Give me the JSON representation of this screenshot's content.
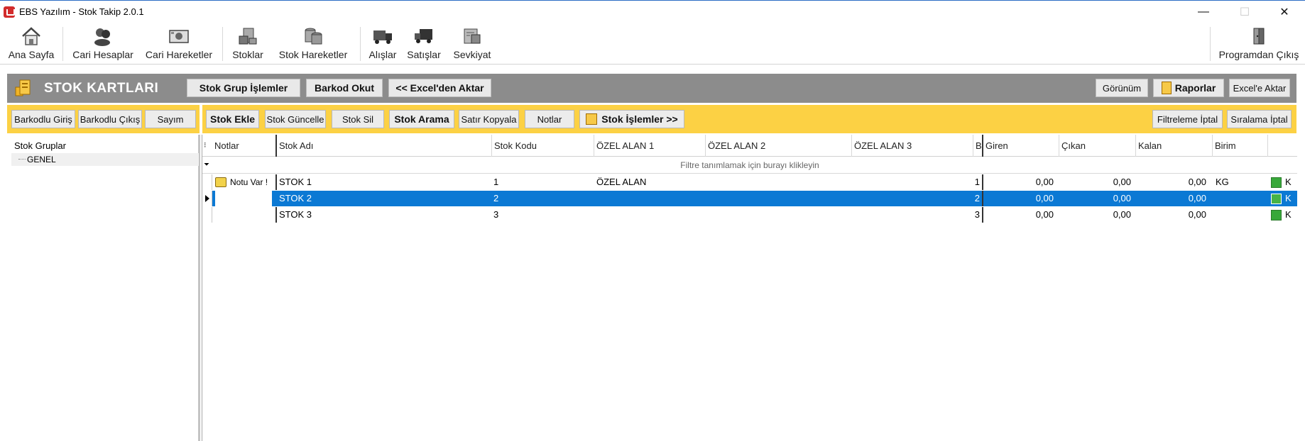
{
  "window": {
    "title": "EBS Yazılım - Stok Takip 2.0.1",
    "minimize": "—",
    "maximize": "☐",
    "close": "✕"
  },
  "toolbar": {
    "items": [
      {
        "label": "Ana Sayfa",
        "icon": "home-icon"
      },
      {
        "label": "Cari Hesaplar",
        "icon": "users-icon"
      },
      {
        "label": "Cari Hareketler",
        "icon": "cash-register-icon"
      },
      {
        "label": "Stoklar",
        "icon": "stock-icon"
      },
      {
        "label": "Stok Hareketler",
        "icon": "stock-movements-icon"
      },
      {
        "label": "Alışlar",
        "icon": "truck-icon"
      },
      {
        "label": "Satışlar",
        "icon": "delivery-truck-icon"
      },
      {
        "label": "Sevkiyat",
        "icon": "shipment-icon"
      }
    ],
    "exit_label": "Programdan Çıkış"
  },
  "header": {
    "title": "STOK KARTLARI",
    "buttons": {
      "group": "Stok Grup İşlemler",
      "barcode": "Barkod Okut",
      "excel_import": "<< Excel'den Aktar",
      "view": "Görünüm",
      "reports": "Raporlar",
      "excel_export": "Excel'e Aktar"
    }
  },
  "actions": {
    "left": {
      "barcode_in": "Barkodlu Giriş",
      "barcode_out": "Barkodlu Çıkış",
      "count": "Sayım"
    },
    "stock_add": "Stok Ekle",
    "stock_update": "Stok Güncelle",
    "stock_delete": "Stok Sil",
    "stock_search": "Stok Arama",
    "copy_row": "Satır Kopyala",
    "notes": "Notlar",
    "stock_ops": "Stok İşlemler >>",
    "filter_cancel": "Filtreleme İptal",
    "sort_cancel": "Sıralama İptal"
  },
  "tree": {
    "root": "Stok Gruplar",
    "children": [
      "GENEL"
    ]
  },
  "grid": {
    "columns": [
      "Notlar",
      "Stok Adı",
      "Stok Kodu",
      "ÖZEL ALAN 1",
      "ÖZEL ALAN 2",
      "ÖZEL ALAN 3",
      "Ba",
      "Giren",
      "Çıkan",
      "Kalan",
      "Birim"
    ],
    "filter_hint": "Filtre tanımlamak için burayı klikleyin",
    "rows": [
      {
        "note": "Notu Var !",
        "name": "STOK 1",
        "code": "1",
        "ozel1": "ÖZEL ALAN",
        "ba": "1",
        "giren": "0,00",
        "cikan": "0,00",
        "kalan": "0,00",
        "birim": "KG",
        "flag": "K",
        "selected": false
      },
      {
        "note": "",
        "name": "STOK 2",
        "code": "2",
        "ozel1": "",
        "ba": "2",
        "giren": "0,00",
        "cikan": "0,00",
        "kalan": "0,00",
        "birim": "",
        "flag": "K",
        "selected": true
      },
      {
        "note": "",
        "name": "STOK 3",
        "code": "3",
        "ozel1": "",
        "ba": "3",
        "giren": "0,00",
        "cikan": "0,00",
        "kalan": "0,00",
        "birim": "",
        "flag": "K",
        "selected": false
      }
    ]
  },
  "colors": {
    "header_band": "#8c8c8c",
    "action_band": "#fcd144",
    "selection": "#0b79d4",
    "status_green": "#38a83a",
    "app_icon": "#d22b2b"
  }
}
